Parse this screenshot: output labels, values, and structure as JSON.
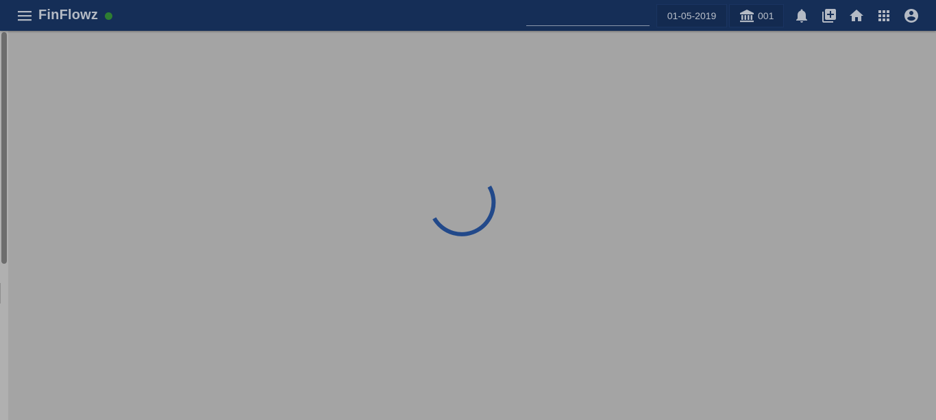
{
  "header": {
    "app_title": "FinFlowz",
    "status": "online",
    "search": {
      "value": "",
      "placeholder": ""
    },
    "business_date": "01-05-2019",
    "branch_code": "001",
    "icons": [
      "menu-icon",
      "bank-icon",
      "notifications-icon",
      "add-box-icon",
      "home-icon",
      "apps-icon",
      "account-circle-icon"
    ]
  },
  "main": {
    "state": "loading"
  },
  "colors": {
    "topbar": "#152e57",
    "overlay": "#a4a4a4",
    "spinner": "#22498a",
    "status_dot": "#2e7d32",
    "icon": "#b4bac4"
  }
}
